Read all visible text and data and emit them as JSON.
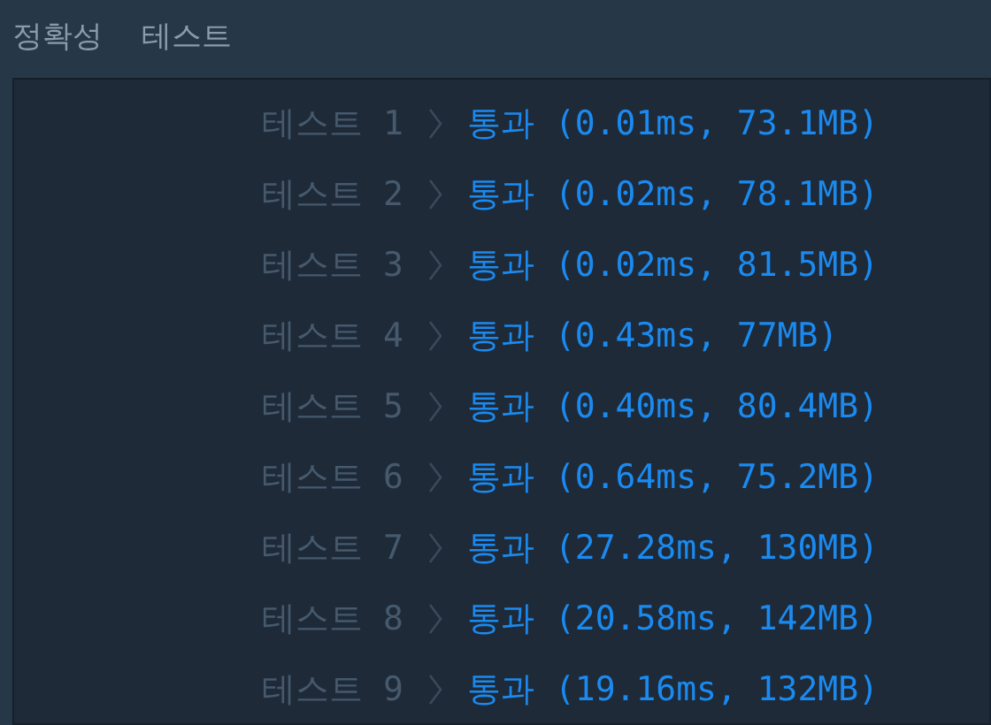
{
  "header": {
    "title": "정확성",
    "subtitle": "테스트"
  },
  "rows": [
    {
      "label": "테스트 1",
      "result": "통과 (0.01ms, 73.1MB)"
    },
    {
      "label": "테스트 2",
      "result": "통과 (0.02ms, 78.1MB)"
    },
    {
      "label": "테스트 3",
      "result": "통과 (0.02ms, 81.5MB)"
    },
    {
      "label": "테스트 4",
      "result": "통과 (0.43ms, 77MB)"
    },
    {
      "label": "테스트 5",
      "result": "통과 (0.40ms, 80.4MB)"
    },
    {
      "label": "테스트 6",
      "result": "통과 (0.64ms, 75.2MB)"
    },
    {
      "label": "테스트 7",
      "result": "통과 (27.28ms, 130MB)"
    },
    {
      "label": "테스트 8",
      "result": "통과 (20.58ms, 142MB)"
    },
    {
      "label": "테스트 9",
      "result": "통과 (19.16ms, 132MB)"
    }
  ]
}
